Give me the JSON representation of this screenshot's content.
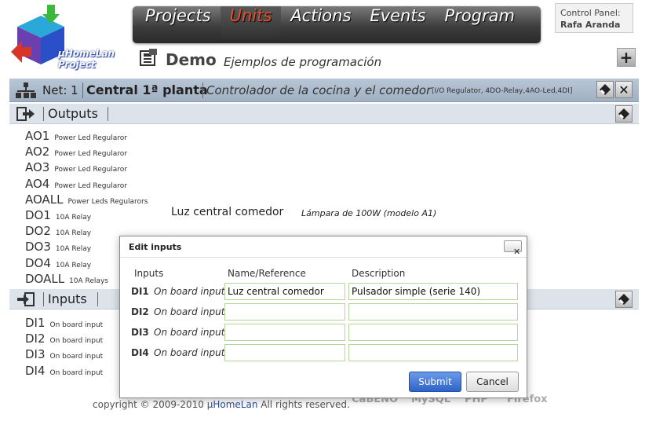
{
  "logo": {
    "line1": "μHomeLan",
    "line2": "Project",
    "icon": "cube-logo-icon"
  },
  "nav": {
    "tabs": [
      {
        "label": "Projects",
        "active": false
      },
      {
        "label": "Units",
        "active": true
      },
      {
        "label": "Actions",
        "active": false
      },
      {
        "label": "Events",
        "active": false
      },
      {
        "label": "Program",
        "active": false
      }
    ]
  },
  "control_panel": {
    "label": "Control Panel:",
    "user": "Rafa Aranda"
  },
  "project": {
    "title": "Demo",
    "description": "Ejemplos de programación"
  },
  "netbar": {
    "net": "Net: 1",
    "central": "Central 1ª planta",
    "controller": "Controlador de la cocina y el comedor",
    "info": "[I/O Regulator, 4DO-Relay,4AO-Led,4DI]"
  },
  "outputs": {
    "label": "Outputs",
    "items": [
      {
        "code": "AO1",
        "type": "Power Led Regularor"
      },
      {
        "code": "AO2",
        "type": "Power Led Regularor"
      },
      {
        "code": "AO3",
        "type": "Power Led Regularor"
      },
      {
        "code": "AO4",
        "type": "Power Led Regularor"
      },
      {
        "code": "AOALL",
        "type": "Power Leds Regularors"
      },
      {
        "code": "DO1",
        "type": "10A Relay"
      },
      {
        "code": "DO2",
        "type": "10A Relay"
      },
      {
        "code": "DO3",
        "type": "10A Relay"
      },
      {
        "code": "DO4",
        "type": "10A Relay"
      },
      {
        "code": "DOALL",
        "type": "10A Relays"
      }
    ],
    "assigned": {
      "name": "Luz central comedor",
      "description": "Lámpara de 100W (modelo A1)"
    }
  },
  "inputs": {
    "label": "Inputs",
    "items": [
      {
        "code": "DI1",
        "type": "On board input"
      },
      {
        "code": "DI2",
        "type": "On board input"
      },
      {
        "code": "DI3",
        "type": "On board input"
      },
      {
        "code": "DI4",
        "type": "On board input"
      }
    ]
  },
  "footer": {
    "copyright": "copyright © 2009-2010",
    "link": "μHomeLan",
    "rights": "All rights reserved.",
    "badges": [
      "CaBENO",
      "MySQL",
      "PHP",
      "Firefox"
    ]
  },
  "dialog": {
    "title": "Edit inputs",
    "close": "✕",
    "headers": {
      "inputs": "Inputs",
      "name": "Name/Reference",
      "description": "Description"
    },
    "rows": [
      {
        "code": "DI1",
        "type": "On board input",
        "name": "Luz central comedor",
        "description": "Pulsador simple (serie 140)"
      },
      {
        "code": "DI2",
        "type": "On board input",
        "name": "",
        "description": ""
      },
      {
        "code": "DI3",
        "type": "On board input",
        "name": "",
        "description": ""
      },
      {
        "code": "DI4",
        "type": "On board input",
        "name": "",
        "description": ""
      }
    ],
    "submit": "Submit",
    "cancel": "Cancel"
  },
  "colors": {
    "accent": "#e8502a",
    "netbar": "#a9b8ca",
    "section": "#dde3ea",
    "submit": "#2e63c8",
    "input_border": "#b5d49b"
  }
}
